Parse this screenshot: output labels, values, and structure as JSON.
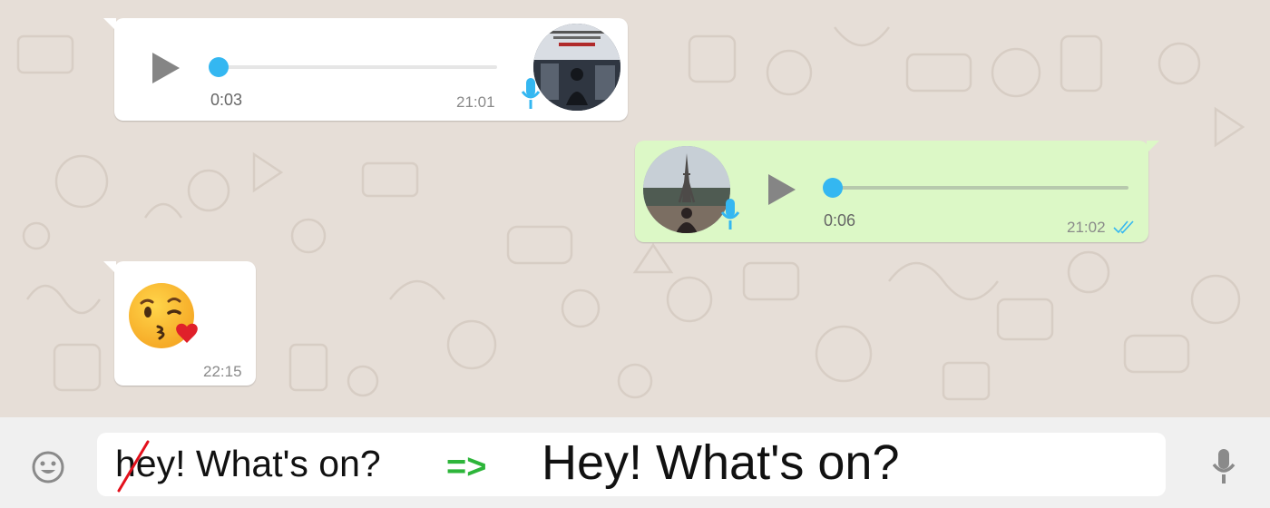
{
  "messages": [
    {
      "kind": "voice",
      "direction": "incoming",
      "duration": "0:03",
      "time": "21:01",
      "progress": 0,
      "avatar_icon": "album-cover-avatar",
      "mic_icon": "mic-icon"
    },
    {
      "kind": "voice",
      "direction": "outgoing",
      "duration": "0:06",
      "time": "21:02",
      "progress": 0,
      "avatar_icon": "eiffel-tower-avatar",
      "mic_icon": "mic-icon",
      "status_icon": "double-check-icon"
    },
    {
      "kind": "emoji",
      "direction": "incoming",
      "emoji": "😘",
      "time": "22:15"
    }
  ],
  "composer": {
    "typed_text": "hey! What's on?",
    "arrow": "=>",
    "corrected_text": "Hey! What's on?",
    "emoji_icon": "smiley-icon",
    "mic_icon": "mic-icon"
  },
  "colors": {
    "incoming_bubble": "#ffffff",
    "outgoing_bubble": "#dcf8c6",
    "accent_blue": "#34b7f1",
    "arrow_green": "#2db53a",
    "strike_red": "#e3101c"
  }
}
